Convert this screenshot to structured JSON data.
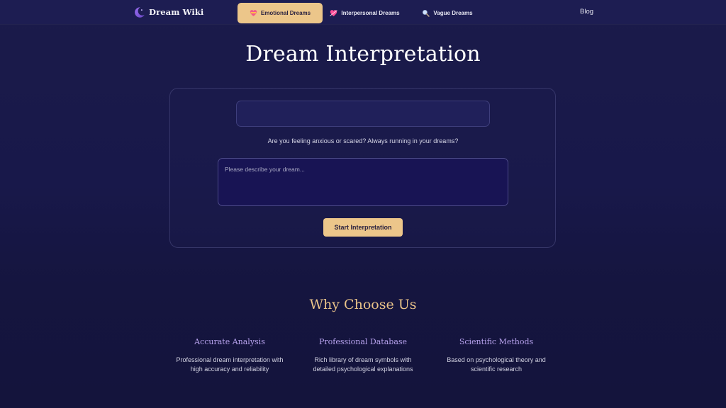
{
  "nav": {
    "brand": "Dream Wiki",
    "blog": "Blog"
  },
  "hero": {
    "title": "Dream Interpretation"
  },
  "tabs": [
    {
      "label": "Emotional Dreams",
      "icon": "heart-ribbon-icon",
      "active": true
    },
    {
      "label": "Interpersonal Dreams",
      "icon": "heart-arrow-icon",
      "active": false
    },
    {
      "label": "Vague Dreams",
      "icon": "magnifier-icon",
      "active": false
    }
  ],
  "prompt": "Are you feeling anxious or scared? Always running in your dreams?",
  "dream_input": {
    "value": "",
    "placeholder": "Please describe your dream..."
  },
  "start_button": "Start Interpretation",
  "why": {
    "title": "Why Choose Us",
    "features": [
      {
        "title": "Accurate Analysis",
        "desc_1": "Professional dream interpretation with",
        "desc_2": "high accuracy and reliability"
      },
      {
        "title": "Professional Database",
        "desc_1": "Rich library of dream symbols with",
        "desc_2": "detailed psychological explanations"
      },
      {
        "title": "Scientific Methods",
        "desc_1": "Based on psychological theory and",
        "desc_2": "scientific research"
      }
    ]
  },
  "colors": {
    "accent": "#ecc68a",
    "background": "#1b1b4a",
    "feature_title": "#b7a2ee",
    "section_title": "#e9c389"
  }
}
